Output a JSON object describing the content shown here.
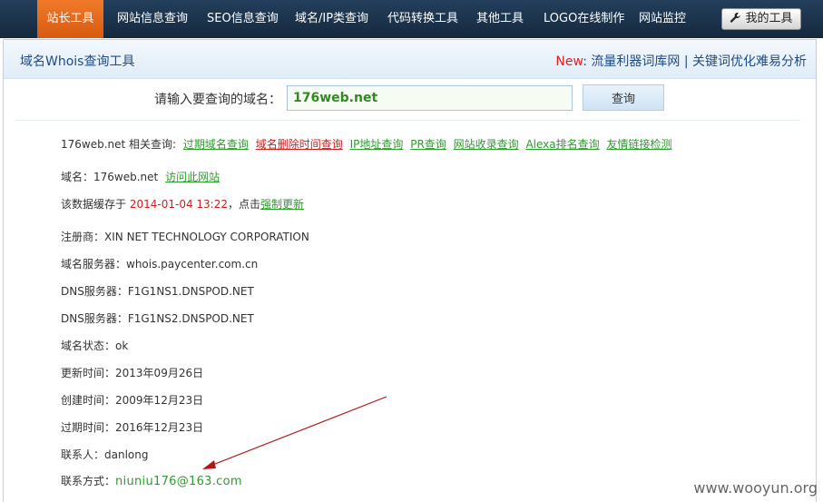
{
  "nav": {
    "items": [
      "站长工具",
      "网站信息查询",
      "SEO信息查询",
      "域名/IP类查询",
      "代码转换工具",
      "其他工具",
      "LOGO在线制作",
      "网站监控"
    ],
    "my_tools": "我的工具"
  },
  "bar": {
    "title": "域名Whois查询工具",
    "new_label": "New",
    "colon": ":",
    "link1": "流量利器词库网",
    "sep": "|",
    "link2": "关键词优化难易分析"
  },
  "search": {
    "label": "请输入要查询的域名：",
    "value": "176web.net",
    "button": "查询"
  },
  "related": {
    "prefix": "176web.net 相关查询:",
    "links": [
      "过期域名查询",
      "域名删除时间查询",
      "IP地址查询",
      "PR查询",
      "网站收录查询",
      "Alexa排名查询",
      "友情链接检测"
    ]
  },
  "domain_line": {
    "label": "域名：176web.net",
    "link": "访问此网站"
  },
  "cache_line": {
    "prefix": "该数据缓存于",
    "time": "2014-01-04 13:22",
    "mid": "，点击",
    "link": "强制更新"
  },
  "records": [
    {
      "label": "注册商：",
      "value": "XIN NET TECHNOLOGY CORPORATION"
    },
    {
      "label": "域名服务器：",
      "value": "whois.paycenter.com.cn"
    },
    {
      "label": "DNS服务器：",
      "value": "F1G1NS1.DNSPOD.NET"
    },
    {
      "label": "DNS服务器：",
      "value": "F1G1NS2.DNSPOD.NET"
    },
    {
      "label": "域名状态：",
      "value": "ok"
    },
    {
      "label": "更新时间：",
      "value": "2013年09月26日"
    },
    {
      "label": "创建时间：",
      "value": "2009年12月23日"
    },
    {
      "label": "过期时间：",
      "value": "2016年12月23日"
    },
    {
      "label": "联系人：",
      "value": "danlong"
    }
  ],
  "contact": {
    "label": "联系方式：",
    "value": "niuniu176@163.com"
  },
  "watermark": "www.wooyun.org",
  "colors": {
    "nav_bg": "#1c344f",
    "nav_active": "#e8691c",
    "link_green": "#2e9b2e",
    "link_red": "#cc1f1f",
    "bar_text": "#1f4a87"
  }
}
